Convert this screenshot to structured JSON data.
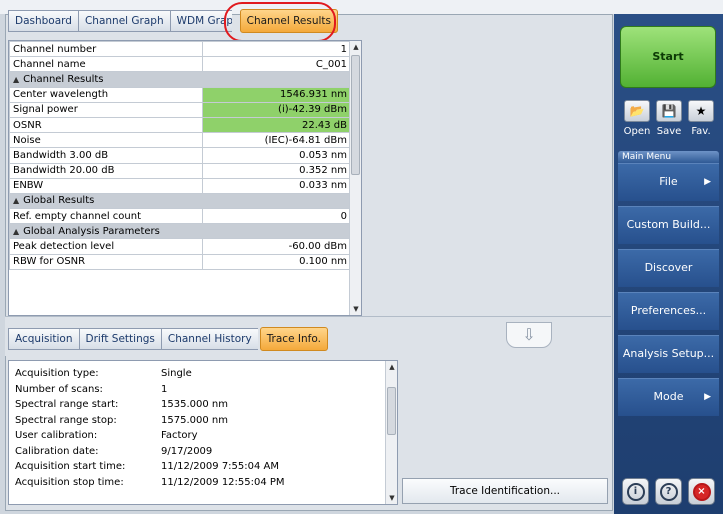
{
  "top_tabs": [
    "Dashboard",
    "Channel Graph",
    "WDM Graph",
    "Channel Results"
  ],
  "results_table": [
    {
      "type": "row",
      "label": "Channel number",
      "value": "1"
    },
    {
      "type": "row",
      "label": "Channel name",
      "value": "C_001"
    },
    {
      "type": "section",
      "label": "Channel Results"
    },
    {
      "type": "row",
      "label": "Center wavelength",
      "value": "1546.931 nm",
      "highlight": true
    },
    {
      "type": "row",
      "label": "Signal power",
      "value": "(i)-42.39 dBm",
      "highlight": true
    },
    {
      "type": "row",
      "label": "OSNR",
      "value": "22.43 dB",
      "highlight": true
    },
    {
      "type": "row",
      "label": "Noise",
      "value": "(IEC)-64.81 dBm"
    },
    {
      "type": "row",
      "label": "Bandwidth 3.00 dB",
      "value": "0.053 nm"
    },
    {
      "type": "row",
      "label": "Bandwidth 20.00 dB",
      "value": "0.352 nm"
    },
    {
      "type": "row",
      "label": "ENBW",
      "value": "0.033 nm"
    },
    {
      "type": "section",
      "label": "Global Results"
    },
    {
      "type": "row",
      "label": "Ref. empty channel count",
      "value": "0"
    },
    {
      "type": "section",
      "label": "Global Analysis Parameters"
    },
    {
      "type": "row",
      "label": "Peak detection level",
      "value": "-60.00 dBm"
    },
    {
      "type": "row",
      "label": "RBW for OSNR",
      "value": "0.100 nm"
    }
  ],
  "bottom_tabs": [
    "Acquisition",
    "Drift Settings",
    "Channel History",
    "Trace Info."
  ],
  "trace_info": [
    {
      "label": "Acquisition type:",
      "value": "Single"
    },
    {
      "label": "Number of scans:",
      "value": "1"
    },
    {
      "label": "Spectral range start:",
      "value": "1535.000 nm"
    },
    {
      "label": "Spectral range stop:",
      "value": "1575.000 nm"
    },
    {
      "label": "User calibration:",
      "value": "Factory"
    },
    {
      "label": "Calibration date:",
      "value": "9/17/2009"
    },
    {
      "label": "Acquisition start time:",
      "value": "11/12/2009 7:55:04 AM"
    },
    {
      "label": "Acquisition stop time:",
      "value": "11/12/2009 12:55:04 PM"
    }
  ],
  "trace_button": "Trace Identification...",
  "sidebar": {
    "start": "Start",
    "quick": [
      {
        "label": "Open",
        "icon": "folder-open-icon"
      },
      {
        "label": "Save",
        "icon": "save-icon"
      },
      {
        "label": "Fav.",
        "icon": "star-icon"
      }
    ],
    "menu_caption": "Main Menu",
    "menu": [
      {
        "label": "File",
        "arrow": true
      },
      {
        "label": "Custom Build...",
        "arrow": false
      },
      {
        "label": "Discover",
        "arrow": false
      },
      {
        "label": "Preferences...",
        "arrow": false
      },
      {
        "label": "Analysis Setup...",
        "arrow": false
      },
      {
        "label": "Mode",
        "arrow": true
      }
    ],
    "bottom_icons": [
      "info-icon",
      "help-icon",
      "close-icon"
    ]
  },
  "colors": {
    "highlight": "#8fd16a",
    "active_tab": "#f4a93b",
    "sidebar": "#27508d",
    "start": "#52b133"
  }
}
